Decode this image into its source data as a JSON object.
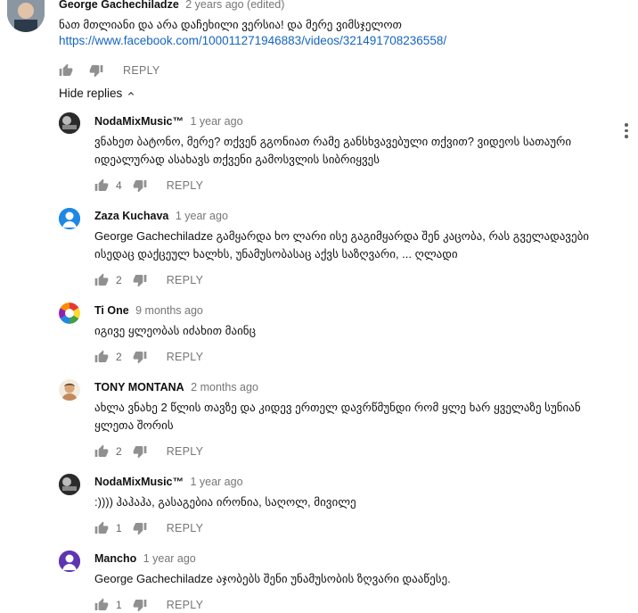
{
  "top_comment": {
    "author": "George Gachechiladze",
    "time": "2 years ago (edited)",
    "text": "ნათ მთლიანი და არა დაჩეხილი ვერსია! და მერე ვიმსჯელოთ",
    "link": "https://www.facebook.com/100011271946883/videos/321491708236558/",
    "reply_label": "REPLY"
  },
  "hide_replies_label": "Hide replies",
  "replies": [
    {
      "author": "NodaMixMusic™",
      "time": "1 year ago",
      "text": "ვნახეთ ბატონო, მერე? თქვენ გგონიათ რამე განსხვავებული თქვით? ვიდეოს სათაური იდეალურად ასახავს თქვენი გამოსვლის სიბრიყვეს",
      "likes": "4",
      "reply_label": "REPLY"
    },
    {
      "author": "Zaza Kuchava",
      "time": "1 year ago",
      "text": "George Gachechiladze გამყარდა ხო ლარი ისე გაგიმყარდა შენ კაცობა, რას გველადავები ისედაც დაქცეულ ხალხს, უნამუსობასაც აქვს საზღვარი, ... ღლადი",
      "likes": "2",
      "reply_label": "REPLY"
    },
    {
      "author": "Ti One",
      "time": "9 months ago",
      "text": "იგივე ყლეობას იძახით მაინც",
      "likes": "2",
      "reply_label": "REPLY"
    },
    {
      "author": "TONY MONTANA",
      "time": "2 months ago",
      "text": "ახლა ვნახე 2 წლის თავზე და კიდევ ერთელ დავრწმუნდი რომ ყლე ხარ ყველაზე სუნიან ყლეთა შორის",
      "likes": "2",
      "reply_label": "REPLY"
    },
    {
      "author": "NodaMixMusic™",
      "time": "1 year ago",
      "text": ":)))) ჰაჰაჰა, გასაგებია ირონია, საღოლ, მივილე",
      "likes": "1",
      "reply_label": "REPLY"
    },
    {
      "author": "Mancho",
      "time": "1 year ago",
      "text": "George Gachechiladze აჯობებს შენი უნამუსობის ზღვარი დააწესე.",
      "likes": "1",
      "reply_label": "REPLY"
    }
  ],
  "icons": {
    "like": "thumb-up-icon",
    "dislike": "thumb-down-icon",
    "more": "more-vert-icon",
    "collapse": "chevron-up-icon"
  },
  "colors": {
    "link": "#1565c0",
    "secondary_text": "#767676",
    "icon": "#909090"
  }
}
